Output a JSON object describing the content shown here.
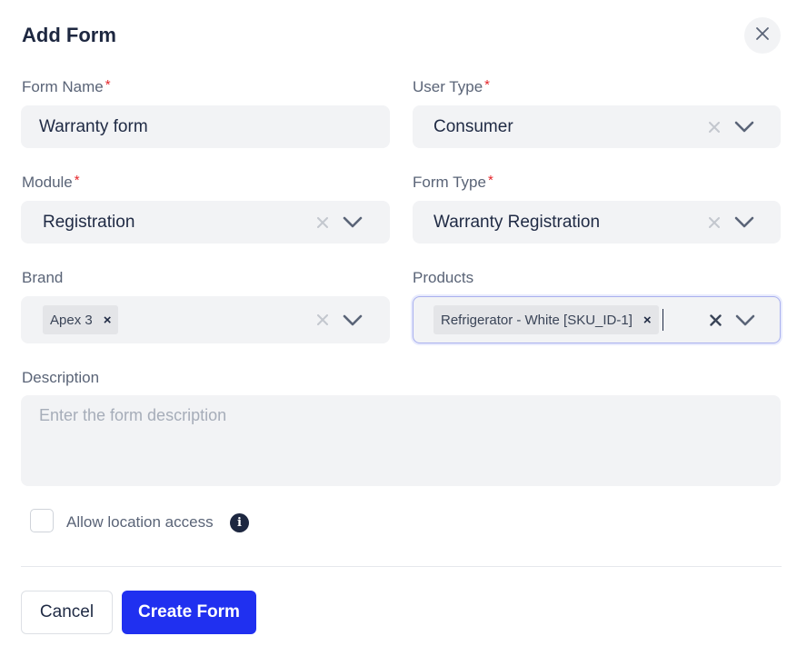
{
  "dialog": {
    "title": "Add Form"
  },
  "fields": {
    "form_name": {
      "label": "Form Name",
      "required_mark": "*",
      "value": "Warranty form"
    },
    "user_type": {
      "label": "User Type",
      "required_mark": "*",
      "value": "Consumer"
    },
    "module": {
      "label": "Module",
      "required_mark": "*",
      "value": "Registration"
    },
    "form_type": {
      "label": "Form Type",
      "required_mark": "*",
      "value": "Warranty Registration"
    },
    "brand": {
      "label": "Brand",
      "chips": [
        "Apex 3"
      ],
      "chip_remove": "×"
    },
    "products": {
      "label": "Products",
      "chips": [
        "Refrigerator - White [SKU_ID-1]"
      ],
      "chip_remove": "×"
    },
    "description": {
      "label": "Description",
      "placeholder": "Enter the form description"
    }
  },
  "location": {
    "label": "Allow location access",
    "checked": false,
    "info_glyph": "i"
  },
  "footer": {
    "cancel_label": "Cancel",
    "create_label": "Create Form"
  },
  "icons": {
    "close": "close-icon",
    "clear": "clear-icon",
    "dropdown": "chevron-down-icon",
    "info": "info-icon"
  },
  "colors": {
    "primary": "#2030f0",
    "required": "#e5252a",
    "field_bg": "#f2f3f5",
    "focus_border": "#a9b0ee"
  }
}
